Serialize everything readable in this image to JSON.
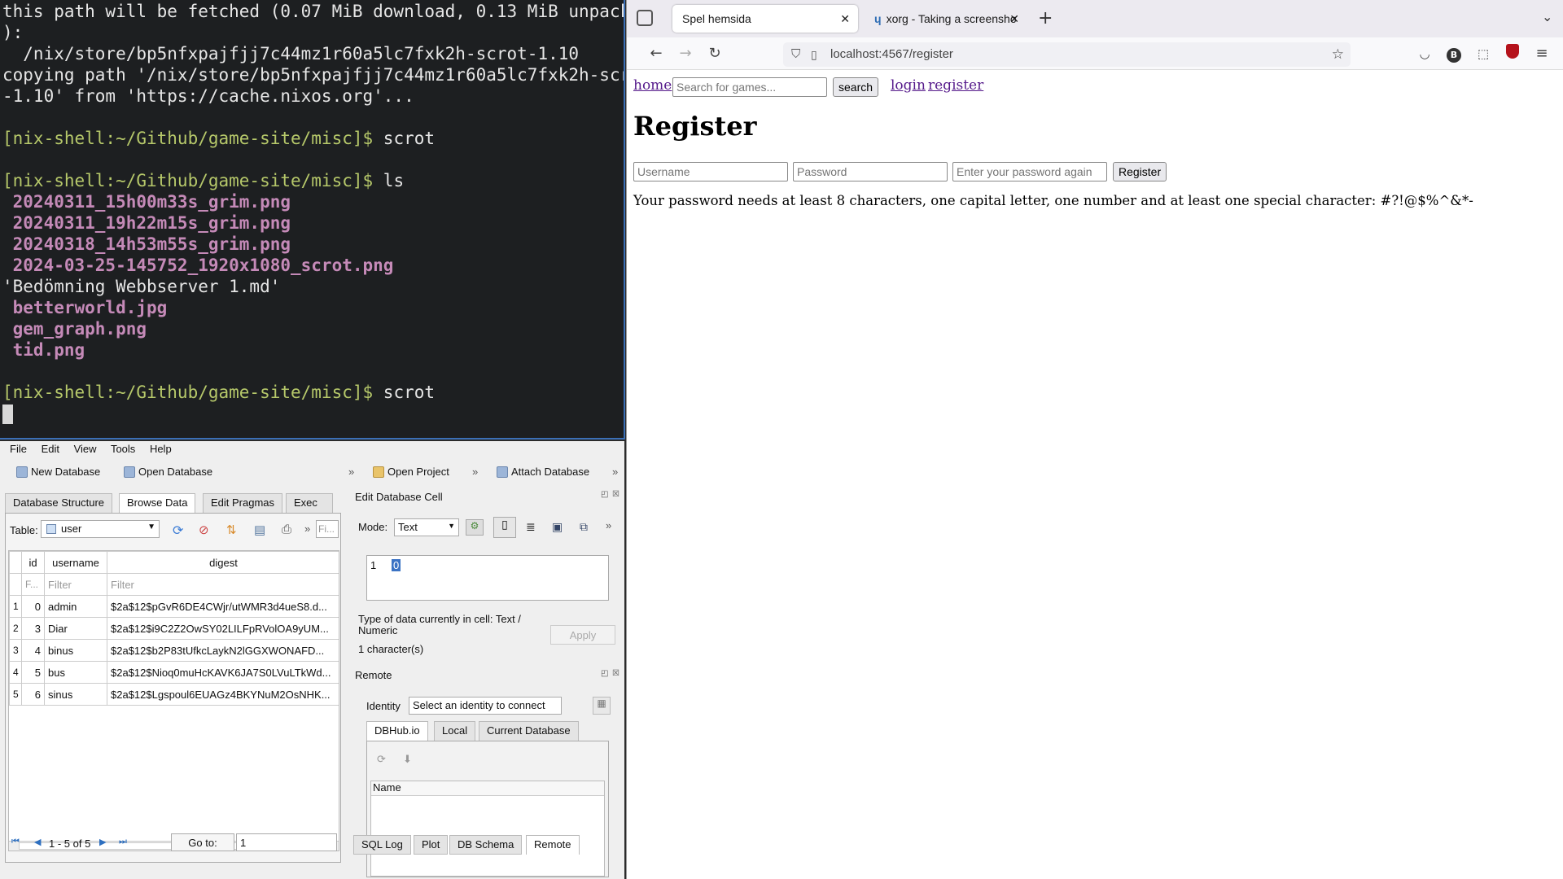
{
  "terminal": {
    "lines": [
      {
        "text": "this path will be fetched (0.07 MiB download, 0.13 MiB unpacked",
        "kind": "plain"
      },
      {
        "text": "):",
        "kind": "plain"
      },
      {
        "text": "  /nix/store/bp5nfxpajfjj7c44mz1r60a5lc7fxk2h-scrot-1.10",
        "kind": "plain"
      },
      {
        "text": "copying path '/nix/store/bp5nfxpajfjj7c44mz1r60a5lc7fxk2h-scrot",
        "kind": "plain"
      },
      {
        "text": "-1.10' from 'https://cache.nixos.org'...",
        "kind": "plain"
      },
      {
        "text": "",
        "kind": "plain"
      },
      {
        "prompt": "[nix-shell:~/Github/game-site/misc]$",
        "cmd": " scrot",
        "kind": "prompt"
      },
      {
        "text": "",
        "kind": "plain"
      },
      {
        "prompt": "[nix-shell:~/Github/game-site/misc]$",
        "cmd": " ls",
        "kind": "prompt"
      },
      {
        "text": " 20240311_15h00m33s_grim.png",
        "kind": "file"
      },
      {
        "text": " 20240311_19h22m15s_grim.png",
        "kind": "file"
      },
      {
        "text": " 20240318_14h53m55s_grim.png",
        "kind": "file"
      },
      {
        "text": " 2024-03-25-145752_1920x1080_scrot.png",
        "kind": "file"
      },
      {
        "text": "'Bedömning Webbserver 1.md'",
        "kind": "plain"
      },
      {
        "text": " betterworld.jpg",
        "kind": "file"
      },
      {
        "text": " gem_graph.png",
        "kind": "file"
      },
      {
        "text": " tid.png",
        "kind": "file"
      },
      {
        "text": "",
        "kind": "plain"
      },
      {
        "prompt": "[nix-shell:~/Github/game-site/misc]$",
        "cmd": " scrot",
        "kind": "prompt"
      }
    ]
  },
  "browser": {
    "tabs": [
      {
        "label": "Spel hemsida",
        "active": true
      },
      {
        "label": "xorg - Taking a screensho",
        "active": false
      }
    ],
    "url": "localhost:4567/register",
    "page": {
      "nav_home": "home",
      "search_placeholder": "Search for games...",
      "search_button": "search",
      "nav_login": "login",
      "nav_register": "register",
      "heading": "Register",
      "username_placeholder": "Username",
      "password_placeholder": "Password",
      "password_again_placeholder": "Enter your password again",
      "register_button": "Register",
      "message": "Your password needs at least 8 characters, one capital letter, one number and at least one special character: #?!@$%^&*-"
    }
  },
  "dbbrowser": {
    "menu": [
      "File",
      "Edit",
      "View",
      "Tools",
      "Help"
    ],
    "toolbar": {
      "new_db": "New Database",
      "open_db": "Open Database",
      "open_project": "Open Project",
      "attach_db": "Attach Database"
    },
    "tabs": [
      "Database Structure",
      "Browse Data",
      "Edit Pragmas",
      "Exec"
    ],
    "table_label": "Table:",
    "table_value": "user",
    "filter_short": "Fi...",
    "columns": [
      "id",
      "username",
      "digest"
    ],
    "filter_placeholder": "Filter",
    "id_filter": "F...",
    "rows": [
      {
        "n": "1",
        "id": "0",
        "username": "admin",
        "digest": "$2a$12$pGvR6DE4CWjr/utWMR3d4ueS8.d..."
      },
      {
        "n": "2",
        "id": "3",
        "username": "Diar",
        "digest": "$2a$12$i9C2Z2OwSY02LILFpRVolOA9yUM..."
      },
      {
        "n": "3",
        "id": "4",
        "username": "binus",
        "digest": "$2a$12$b2P83tUfkcLaykN2lGGXWONAFD..."
      },
      {
        "n": "4",
        "id": "5",
        "username": "bus",
        "digest": "$2a$12$Nioq0muHcKAVK6JA7S0LVuLTkWd..."
      },
      {
        "n": "5",
        "id": "6",
        "username": "sinus",
        "digest": "$2a$12$Lgspoul6EUAGz4BKYNuM2OsNHK..."
      }
    ],
    "pager": "1 - 5 of 5",
    "goto_label": "Go to:",
    "goto_value": "1",
    "edit_cell": {
      "title": "Edit Database Cell",
      "mode_label": "Mode:",
      "mode_value": "Text",
      "line_no": "1",
      "cell_value": "0",
      "type_info": "Type of data currently in cell: Text / Numeric",
      "char_count": "1 character(s)",
      "apply": "Apply"
    },
    "remote": {
      "title": "Remote",
      "identity_label": "Identity",
      "identity_value": "Select an identity to connect",
      "tabs": [
        "DBHub.io",
        "Local",
        "Current Database"
      ],
      "name_col": "Name"
    },
    "bottom_tabs": [
      "SQL Log",
      "Plot",
      "DB Schema",
      "Remote"
    ]
  }
}
